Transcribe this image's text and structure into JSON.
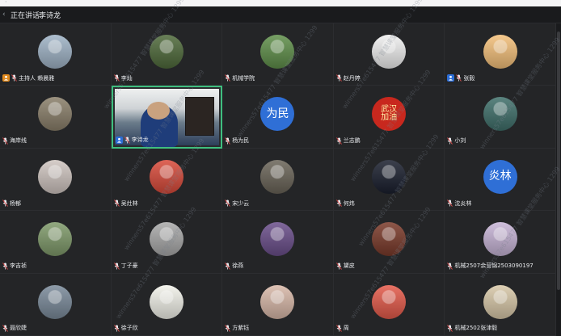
{
  "speaker": {
    "label": "正在讲话:",
    "name": "李诗龙"
  },
  "participants": [
    {
      "name": "主持人 赖晨雅",
      "role": "host",
      "avatar": "person-portrait",
      "bg": "#9fb3c6"
    },
    {
      "name": "李灿",
      "role": "",
      "avatar": "landscape-photo",
      "bg": "#4f6a3b"
    },
    {
      "name": "机械学院",
      "role": "",
      "avatar": "trees-photo",
      "bg": "#5f8f4a"
    },
    {
      "name": "赵丹婷",
      "role": "",
      "avatar": "cat-photo",
      "bg": "#f0f0f0"
    },
    {
      "name": "张毅",
      "role": "cohost",
      "avatar": "cat-illustration",
      "bg": "#f4c07a"
    },
    {
      "name": "海岸线",
      "role": "",
      "avatar": "outdoor-photo",
      "bg": "#8a7f6a"
    },
    {
      "name": "李诗龙",
      "role": "active",
      "avatar": "camera-feed",
      "bg": "#2a2b2e"
    },
    {
      "name": "杨为民",
      "role": "",
      "avatar": "text",
      "text": "为民",
      "bg": "#2f6fd6"
    },
    {
      "name": "兰志鹏",
      "role": "",
      "avatar": "text",
      "text": "武汉\n加油",
      "bg": "#c8281e"
    },
    {
      "name": "小刘",
      "role": "",
      "avatar": "waterfall-photo",
      "bg": "#3f6f6a"
    },
    {
      "name": "杨郁",
      "role": "",
      "avatar": "group-photo",
      "bg": "#cfc5c0"
    },
    {
      "name": "吴灶林",
      "role": "",
      "avatar": "flowers-photo",
      "bg": "#d84a3a"
    },
    {
      "name": "宋少云",
      "role": "",
      "avatar": "night-photo",
      "bg": "#6a6458"
    },
    {
      "name": "何炜",
      "role": "",
      "avatar": "city-night-photo",
      "bg": "#1a1f2e"
    },
    {
      "name": "沈炎林",
      "role": "",
      "avatar": "text",
      "text": "炎林",
      "bg": "#2f6fd6"
    },
    {
      "name": "李吉祯",
      "role": "",
      "avatar": "family-photo",
      "bg": "#7f9a6a"
    },
    {
      "name": "丁子豪",
      "role": "",
      "avatar": "blank",
      "bg": "#a9a9a9"
    },
    {
      "name": "徐燕",
      "role": "",
      "avatar": "sunset-photo",
      "bg": "#6a4e8a"
    },
    {
      "name": "黛皮",
      "role": "",
      "avatar": "building-photo",
      "bg": "#7a3a2a"
    },
    {
      "name": "机械2507余营锦2503090197",
      "role": "",
      "avatar": "anime-photo",
      "bg": "#c7b4d6"
    },
    {
      "name": "聂欣婕",
      "role": "",
      "avatar": "cat-photo-2",
      "bg": "#7a8a9a"
    },
    {
      "name": "徐子欣",
      "role": "",
      "avatar": "cartoon-photo",
      "bg": "#f2f2ea"
    },
    {
      "name": "方紫钰",
      "role": "",
      "avatar": "girl-photo",
      "bg": "#d8b8a8"
    },
    {
      "name": "周",
      "role": "",
      "avatar": "cartoon-photo-2",
      "bg": "#e45a4a"
    },
    {
      "name": "机械2502张津毅",
      "role": "",
      "avatar": "person-photo",
      "bg": "#d8c8a8"
    }
  ],
  "watermark_text": "winners57e615477 智慧课堂服务中心 1299"
}
